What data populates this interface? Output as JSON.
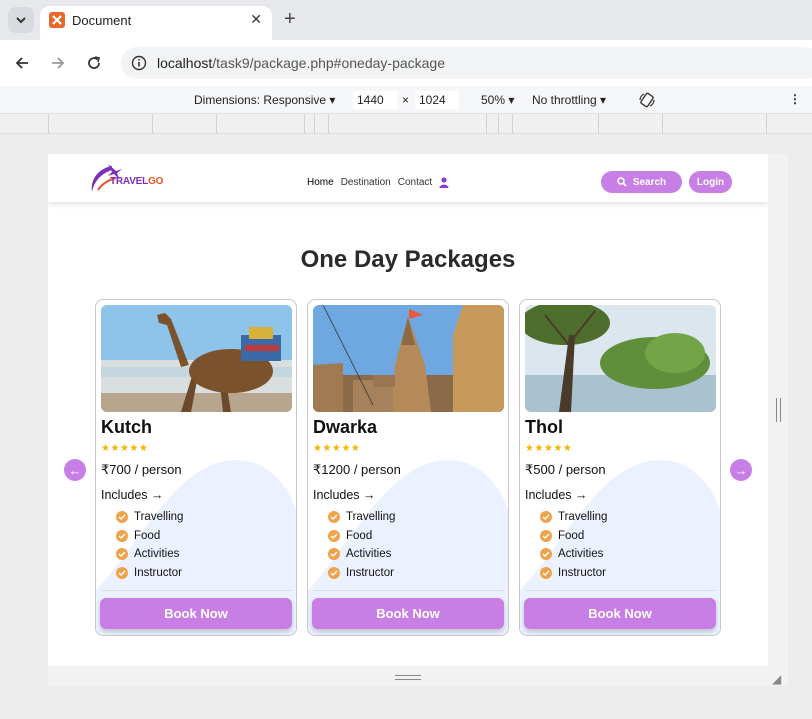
{
  "browser": {
    "tab_title": "Document",
    "url": "localhost/task9/package.php#oneday-package",
    "url_host": "localhost",
    "url_path": "/task9/package.php#oneday-package"
  },
  "devtools": {
    "dimensions_label": "Dimensions: Responsive",
    "width": "1440",
    "times": "×",
    "height": "1024",
    "zoom": "50%",
    "throttling": "No throttling"
  },
  "site": {
    "logo_travel": "TRAVEL",
    "logo_go": "GO",
    "nav": [
      "Home",
      "Destination",
      "Contact"
    ],
    "search_label": "Search",
    "login_label": "Login"
  },
  "section_title": "One Day Packages",
  "arrows": {
    "prev": "←",
    "next": "→"
  },
  "packages": [
    {
      "name": "Kutch",
      "stars": "★★★★★",
      "rating": 5,
      "price": "₹700",
      "per": "/ person",
      "includes": "Includes",
      "features": [
        "Travelling",
        "Food",
        "Activities",
        "Instructor"
      ],
      "cta": "Book Now"
    },
    {
      "name": "Dwarka",
      "stars": "★★★★★",
      "rating": 5,
      "price": "₹1200",
      "per": "/ person",
      "includes": "Includes",
      "features": [
        "Travelling",
        "Food",
        "Activities",
        "Instructor"
      ],
      "cta": "Book Now"
    },
    {
      "name": "Thol",
      "stars": "★★★★★",
      "rating": 5,
      "price": "₹500",
      "per": "/ person",
      "includes": "Includes",
      "features": [
        "Travelling",
        "Food",
        "Activities",
        "Instructor"
      ],
      "cta": "Book Now"
    }
  ],
  "colors": {
    "accent": "#c77fe6",
    "star": "#f4b400",
    "check": "#f0a24a",
    "brand": "#7b2fbe"
  }
}
